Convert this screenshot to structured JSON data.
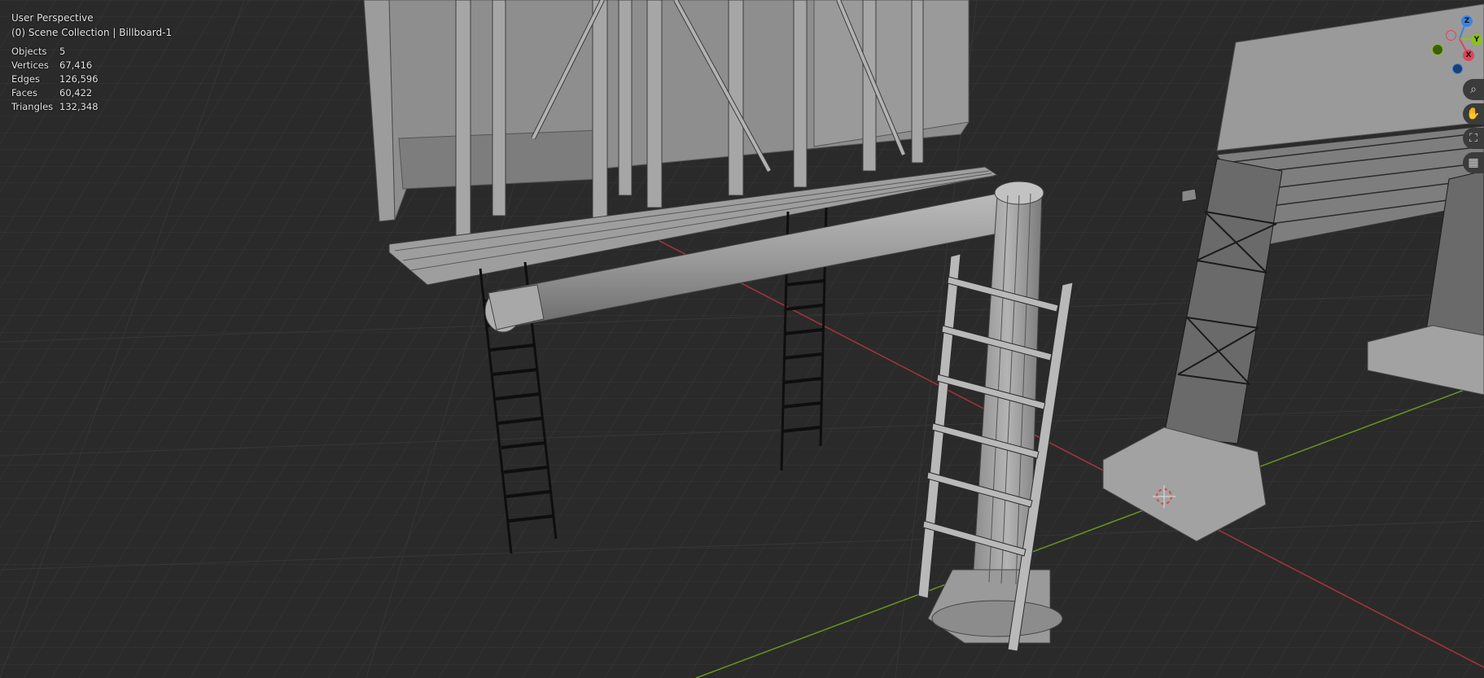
{
  "viewport": {
    "title": "User Perspective",
    "collection": "(0) Scene Collection | Billboard-1"
  },
  "stats": [
    {
      "label": "Objects",
      "value": "5"
    },
    {
      "label": "Vertices",
      "value": "67,416"
    },
    {
      "label": "Edges",
      "value": "126,596"
    },
    {
      "label": "Faces",
      "value": "60,422"
    },
    {
      "label": "Triangles",
      "value": "132,348"
    }
  ],
  "gizmo": {
    "z_label": "Z",
    "y_label": "Y",
    "x_label": "X",
    "colors": {
      "x": "#e0435a",
      "y": "#8bc21b",
      "z": "#3b83e6"
    }
  },
  "tools": [
    {
      "name": "zoom-icon",
      "glyph": "⌕"
    },
    {
      "name": "pan-icon",
      "glyph": "✋"
    },
    {
      "name": "camera-icon",
      "glyph": "⛶"
    },
    {
      "name": "grid-icon",
      "glyph": "▦"
    }
  ]
}
